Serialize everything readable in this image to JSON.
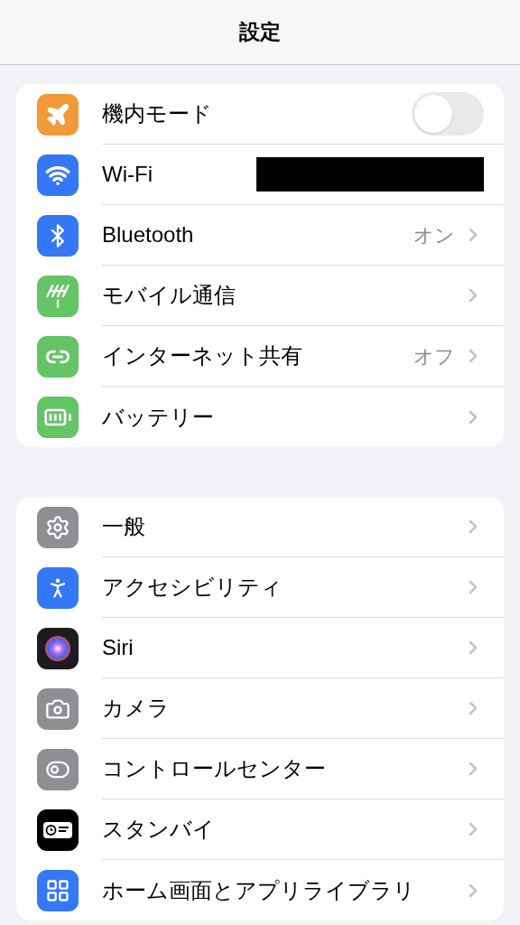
{
  "header": {
    "title": "設定"
  },
  "groups": [
    {
      "rows": [
        {
          "kind": "toggle",
          "label": "機内モード",
          "color": "#f19a37",
          "on": false
        },
        {
          "kind": "redacted",
          "label": "Wi-Fi",
          "color": "#3478f6"
        },
        {
          "kind": "link",
          "label": "Bluetooth",
          "color": "#3478f6",
          "value": "オン"
        },
        {
          "kind": "link",
          "label": "モバイル通信",
          "color": "#65c466"
        },
        {
          "kind": "link",
          "label": "インターネット共有",
          "color": "#65c466",
          "value": "オフ"
        },
        {
          "kind": "link",
          "label": "バッテリー",
          "color": "#65c466"
        }
      ]
    },
    {
      "rows": [
        {
          "kind": "link",
          "label": "一般",
          "color": "#8e8e93"
        },
        {
          "kind": "link",
          "label": "アクセシビリティ",
          "color": "#3478f6"
        },
        {
          "kind": "link",
          "label": "Siri",
          "color": "#1c1c1e"
        },
        {
          "kind": "link",
          "label": "カメラ",
          "color": "#8e8e93"
        },
        {
          "kind": "link",
          "label": "コントロールセンター",
          "color": "#8e8e93"
        },
        {
          "kind": "link",
          "label": "スタンバイ",
          "color": "#000000"
        },
        {
          "kind": "link",
          "label": "ホーム画面とアプリライブラリ",
          "color": "#3478f6"
        }
      ]
    }
  ]
}
